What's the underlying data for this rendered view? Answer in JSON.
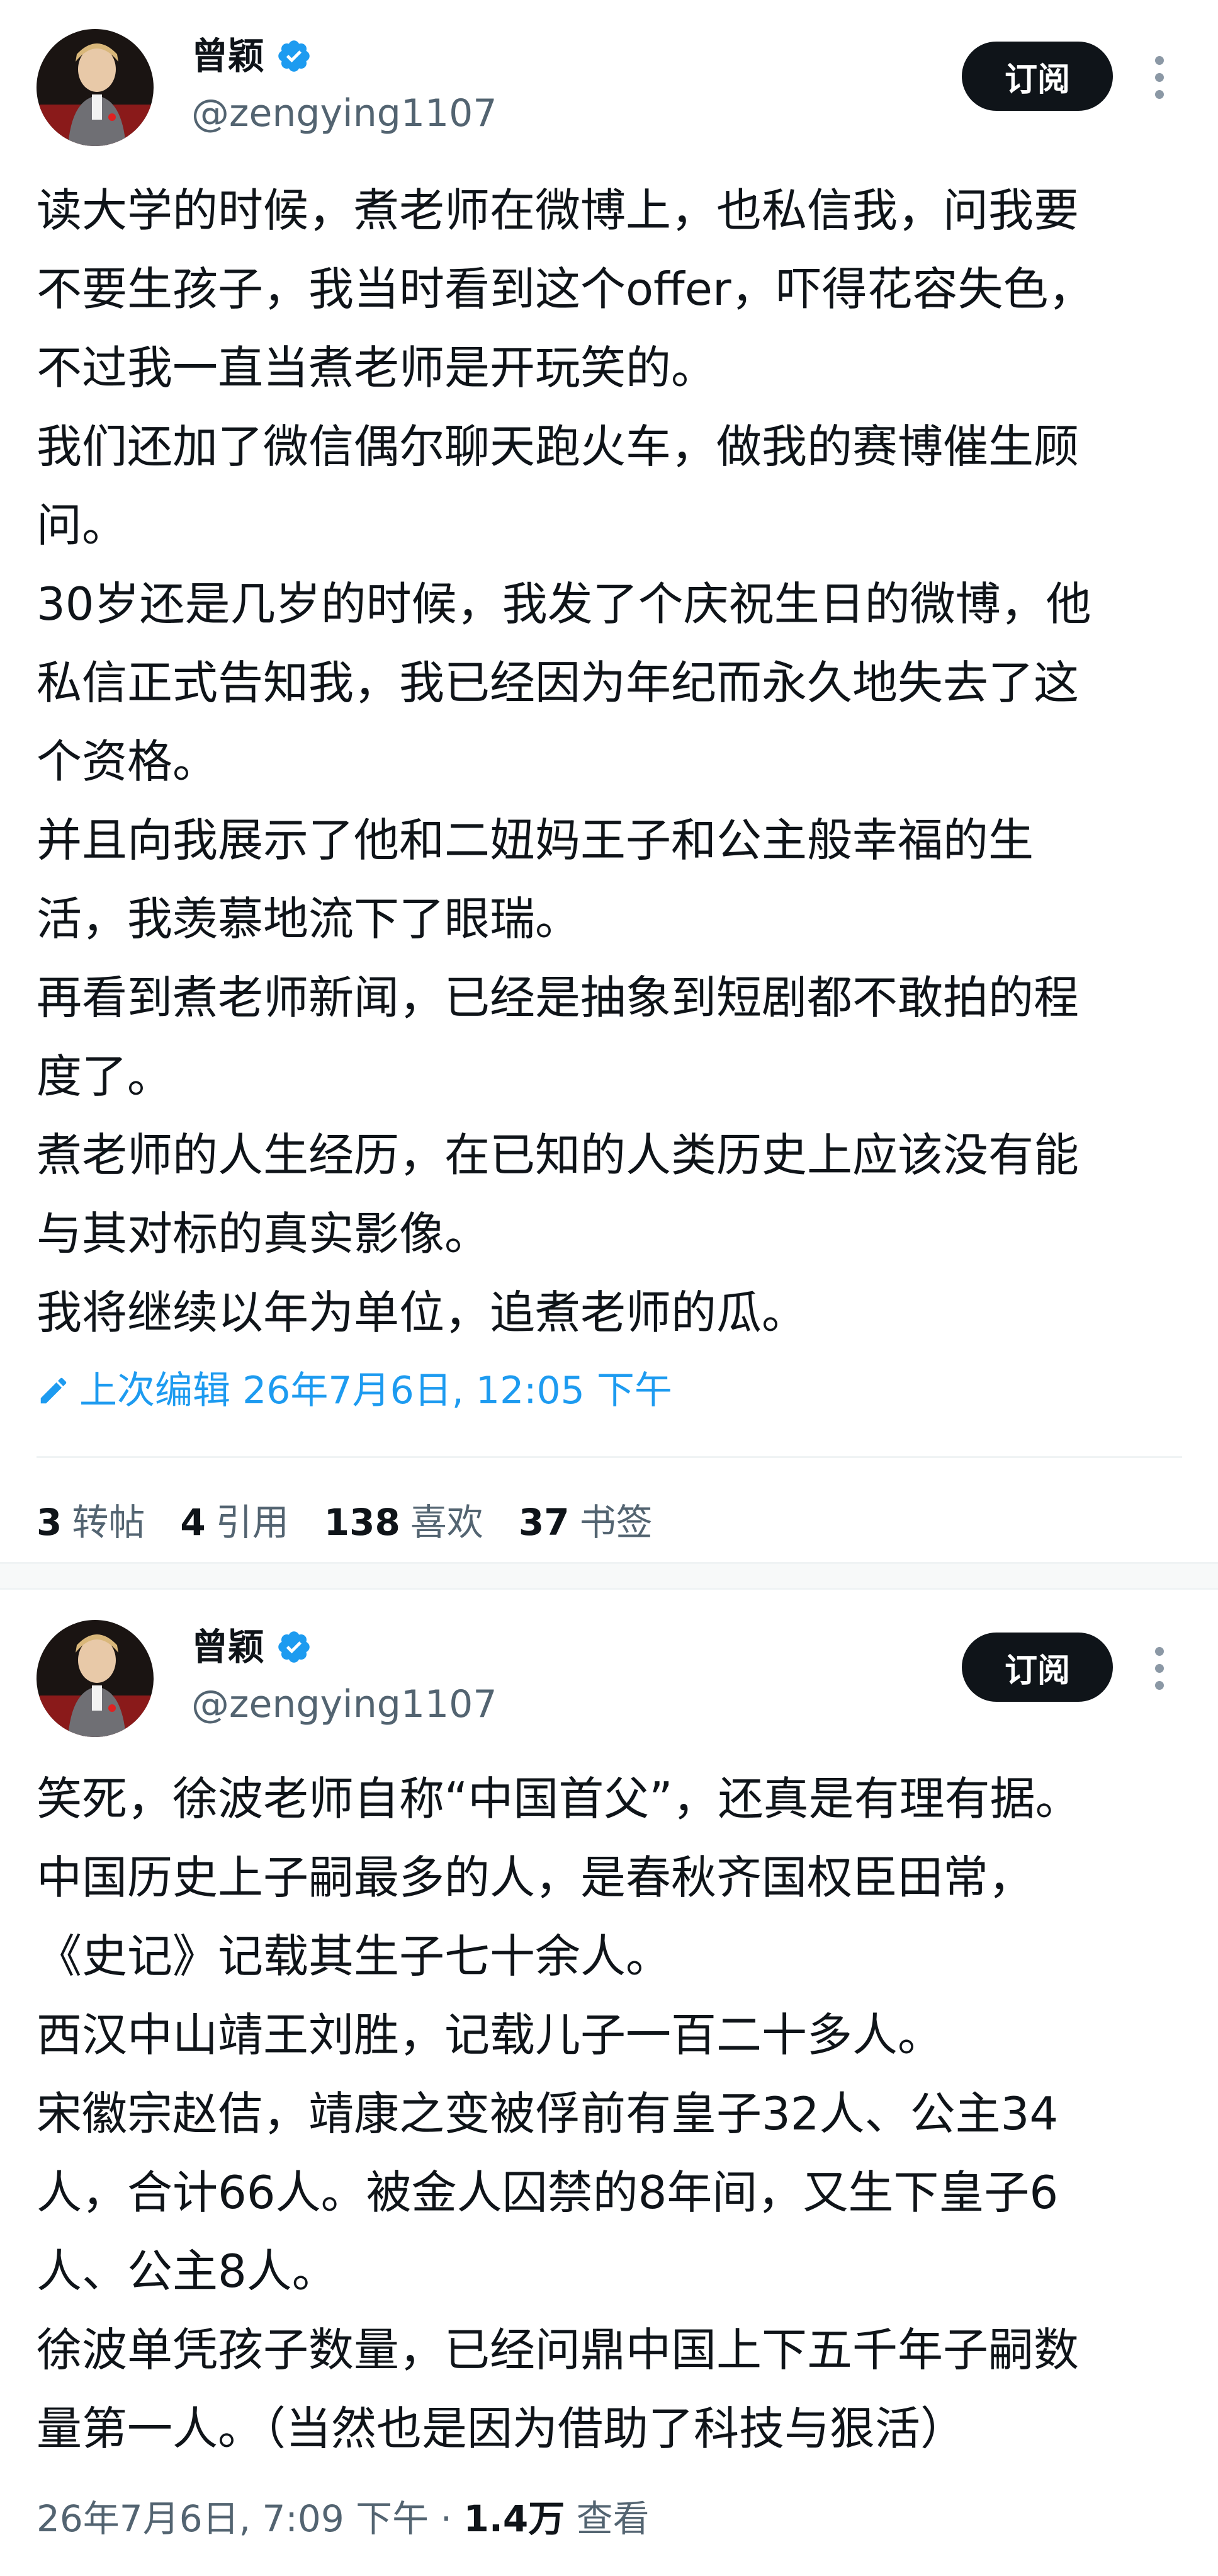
{
  "colors": {
    "text": "#0f1419",
    "secondary": "#536471",
    "accent": "#1d9bf0",
    "button_bg": "#0f1419"
  },
  "posts": [
    {
      "author": {
        "display_name": "曾颖",
        "handle": "@zengying1107",
        "verified_icon": "verified-badge-icon"
      },
      "subscribe_label": "订阅",
      "body_lines": [
        "读大学的时候，煮老师在微博上，也私信我，问我要",
        "不要生孩子，我当时看到这个offer，吓得花容失色，",
        "不过我一直当煮老师是开玩笑的。",
        "我们还加了微信偶尔聊天跑火车，做我的赛博催生顾",
        "问。",
        "30岁还是几岁的时候，我发了个庆祝生日的微博，他",
        "私信正式告知我，我已经因为年纪而永久地失去了这",
        "个资格。",
        "并且向我展示了他和二妞妈王子和公主般幸福的生",
        "活，我羡慕地流下了眼瑞。",
        "再看到煮老师新闻，已经是抽象到短剧都不敢拍的程",
        "度了。",
        "煮老师的人生经历，在已知的人类历史上应该没有能",
        "与其对标的真实影像。",
        "我将继续以年为单位，追煮老师的瓜。"
      ],
      "edited_label": "上次编辑 26年7月6日, 12:05 下午",
      "stats": [
        {
          "num": "3",
          "label": "转帖"
        },
        {
          "num": "4",
          "label": "引用"
        },
        {
          "num": "138",
          "label": "喜欢"
        },
        {
          "num": "37",
          "label": "书签"
        }
      ]
    },
    {
      "author": {
        "display_name": "曾颖",
        "handle": "@zengying1107",
        "verified_icon": "verified-badge-icon"
      },
      "subscribe_label": "订阅",
      "body_lines": [
        "笑死，徐波老师自称“中国首父”，还真是有理有据。",
        "中国历史上子嗣最多的人，是春秋齐国权臣田常，",
        "《史记》记载其生子七十余人。",
        "西汉中山靖王刘胜，记载儿子一百二十多人。",
        "宋徽宗赵佶，靖康之变被俘前有皇子32人、公主34",
        "人，合计66人。被金人囚禁的8年间，又生下皇子6",
        "人、公主8人。",
        "徐波单凭孩子数量，已经问鼎中国上下五千年子嗣数",
        "量第一人。（当然也是因为借助了科技与狠活）"
      ],
      "meta": {
        "timestamp": "26年7月6日, 7:09 下午",
        "separator": " · ",
        "views_count": "1.4万",
        "views_label": "查看"
      }
    }
  ]
}
